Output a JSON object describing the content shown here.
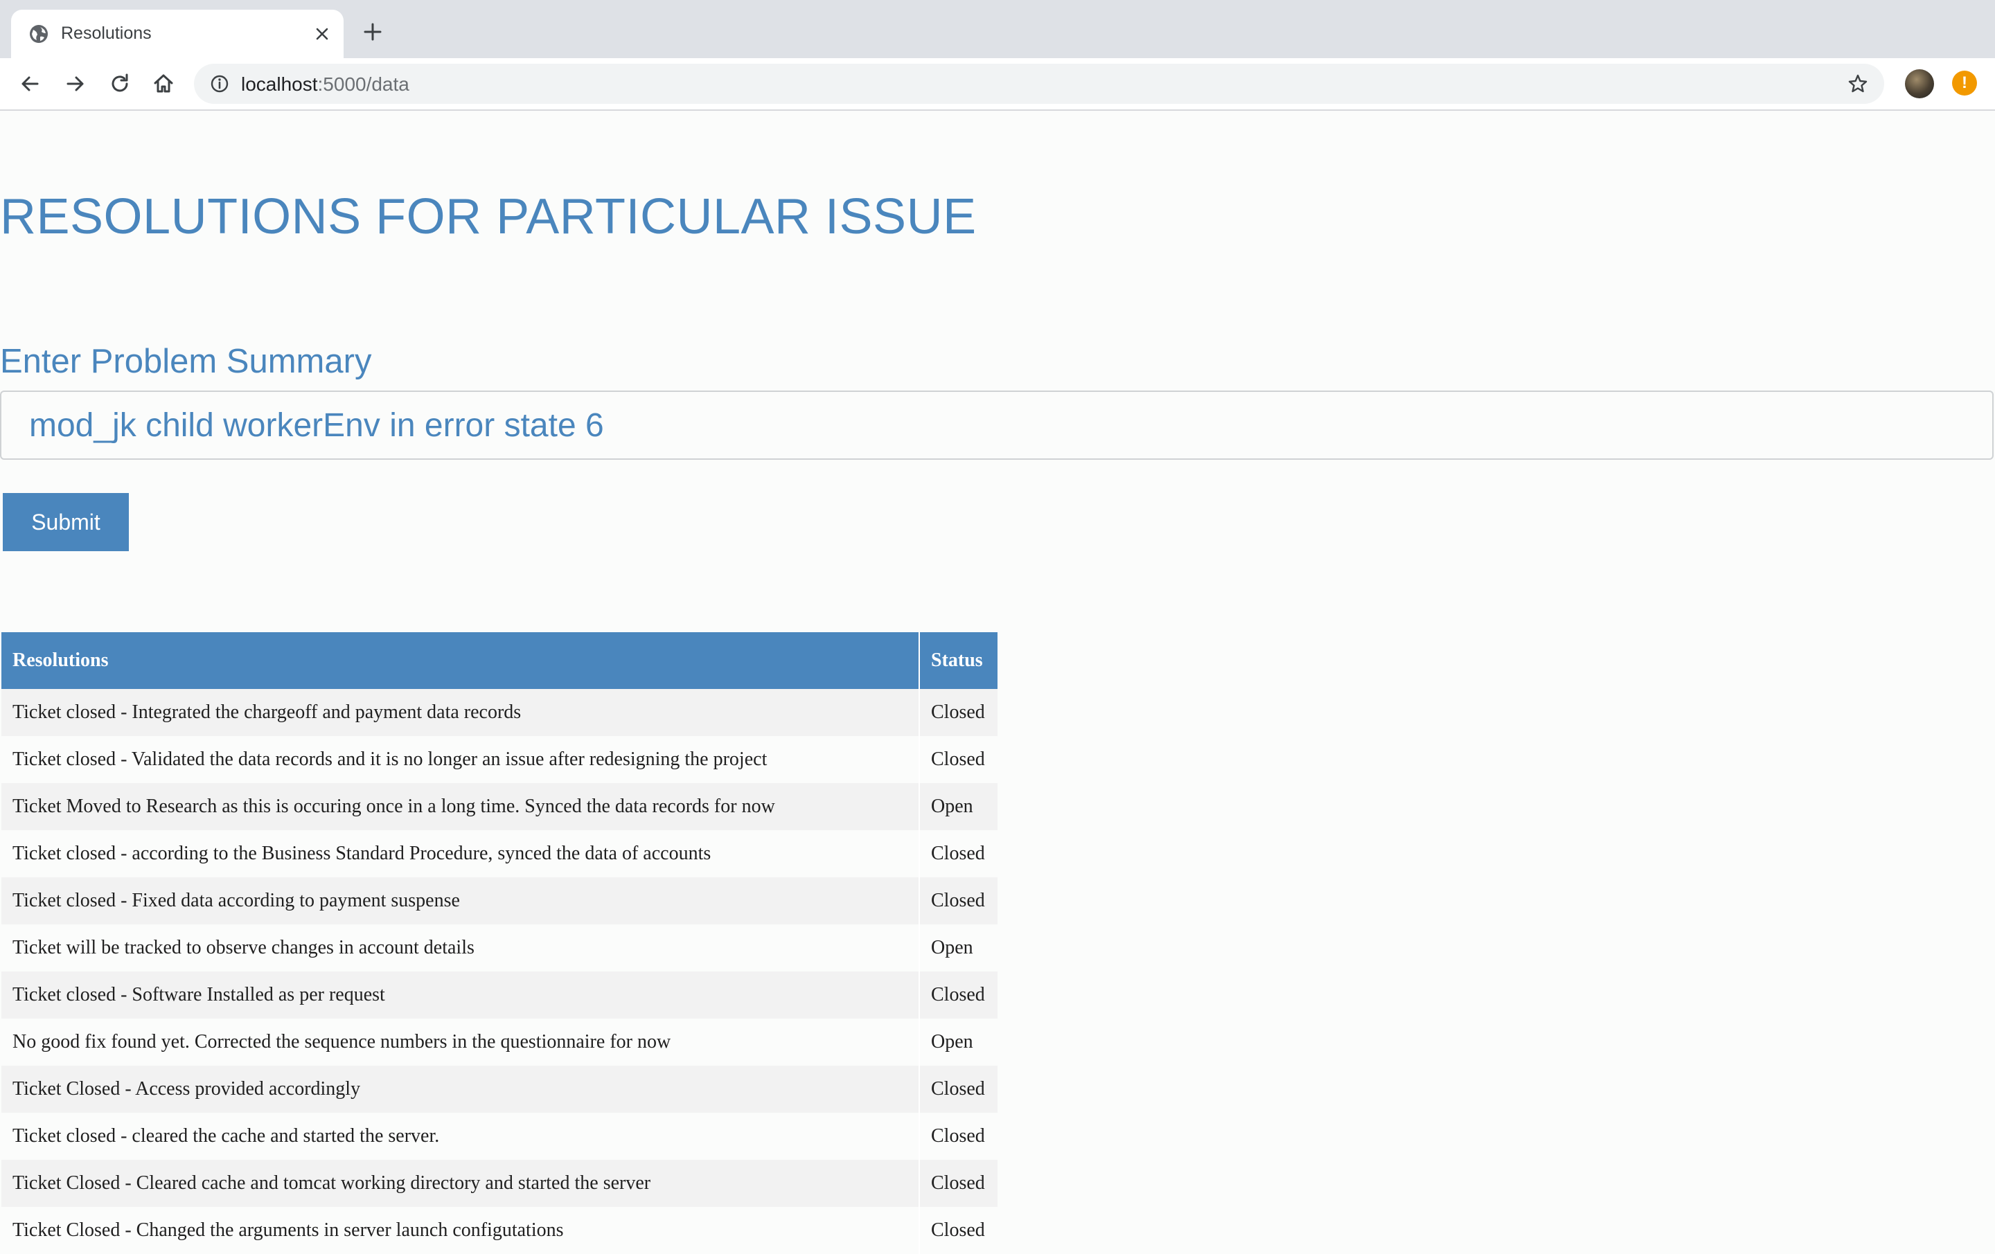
{
  "browser": {
    "tab_title": "Resolutions",
    "url_host": "localhost",
    "url_path": ":5000/data"
  },
  "page": {
    "title": "RESOLUTIONS FOR PARTICULAR ISSUE",
    "field_label": "Enter Problem Summary",
    "input_value": "mod_jk child workerEnv in error state 6",
    "submit_label": "Submit"
  },
  "table": {
    "headers": [
      "Resolutions",
      "Status"
    ],
    "rows": [
      {
        "resolution": "Ticket closed - Integrated the chargeoff and payment data records",
        "status": "Closed"
      },
      {
        "resolution": "Ticket closed - Validated the data records and it is no longer an issue after redesigning the project",
        "status": "Closed"
      },
      {
        "resolution": "Ticket Moved to Research as this is occuring once in a long time. Synced the data records for now",
        "status": "Open"
      },
      {
        "resolution": "Ticket closed - according to the Business Standard Procedure, synced the data of accounts",
        "status": "Closed"
      },
      {
        "resolution": "Ticket closed - Fixed data according to payment suspense",
        "status": "Closed"
      },
      {
        "resolution": "Ticket will be tracked to observe changes in account details",
        "status": "Open"
      },
      {
        "resolution": "Ticket closed - Software Installed as per request",
        "status": "Closed"
      },
      {
        "resolution": "No good fix found yet. Corrected the sequence numbers in the questionnaire for now",
        "status": "Open"
      },
      {
        "resolution": "Ticket Closed - Access provided accordingly",
        "status": "Closed"
      },
      {
        "resolution": "Ticket closed - cleared the cache and started the server.",
        "status": "Closed"
      },
      {
        "resolution": "Ticket Closed - Cleared cache and tomcat working directory and started the server",
        "status": "Closed"
      },
      {
        "resolution": "Ticket Closed - Changed the arguments in server launch configutations",
        "status": "Closed"
      }
    ]
  },
  "icons": {
    "tab_favicon": "globe-icon",
    "tab_close": "close-icon",
    "new_tab": "plus-icon",
    "back": "back-arrow-icon",
    "forward": "forward-arrow-icon",
    "reload": "reload-icon",
    "home": "home-icon",
    "site_info": "info-icon",
    "bookmark": "star-icon",
    "profile": "avatar",
    "alert": "alert-icon"
  },
  "colors": {
    "accent": "#4a86bd",
    "row_stripe": "#f2f2f2",
    "alert": "#f29900"
  }
}
